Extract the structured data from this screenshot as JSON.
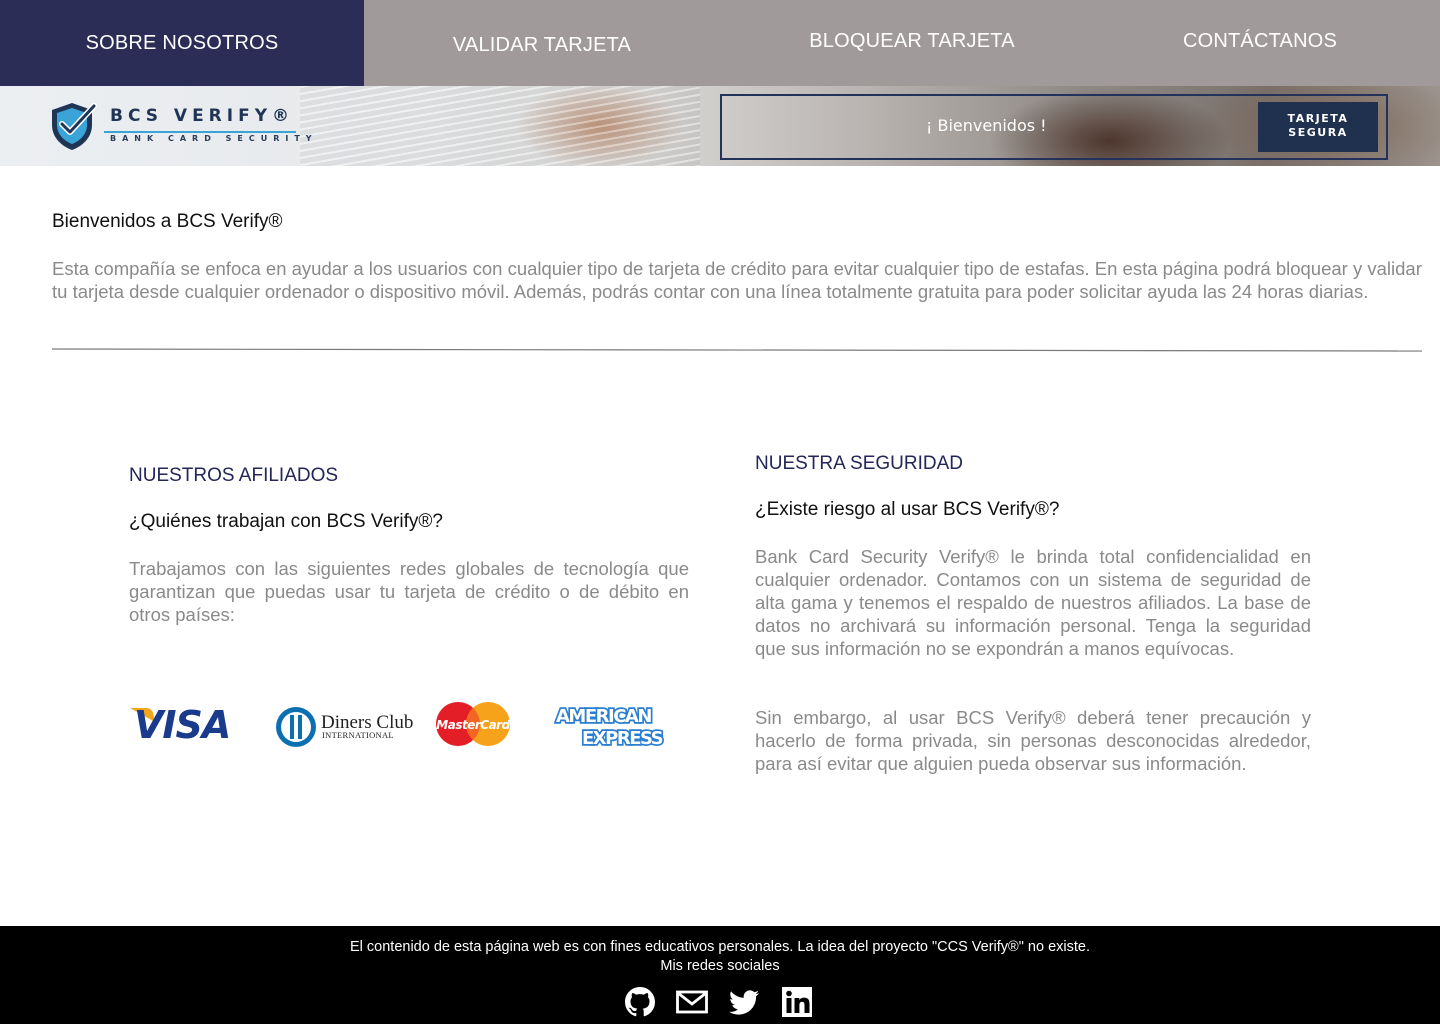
{
  "nav": {
    "items": [
      {
        "label": "SOBRE NOSOTROS",
        "active": true
      },
      {
        "label": "VALIDAR TARJETA",
        "active": false
      },
      {
        "label": "BLOQUEAR TARJETA",
        "active": false
      },
      {
        "label": "CONTÁCTANOS",
        "active": false
      }
    ],
    "active_color": "#2c2d57",
    "bar_color": "#a19a9a"
  },
  "banner": {
    "logo_title": "BCS VERIFY®",
    "logo_subtitle": "BANK CARD SECURITY",
    "welcome": "¡ Bienvenidos !",
    "badge": "TARJETA\nSEGURA"
  },
  "intro": {
    "title": "Bienvenidos a BCS Verify®",
    "body": "Esta compañía se enfoca en ayudar a los usuarios con cualquier tipo de tarjeta de crédito para evitar cualquier tipo de estafas. En esta página podrá bloquear y validar tu tarjeta desde cualquier ordenador o dispositivo móvil. Además, podrás contar con una línea totalmente gratuita para poder solicitar ayuda las 24 horas diarias."
  },
  "affiliates": {
    "heading": "NUESTROS AFILIADOS",
    "question": "¿Quiénes trabajan con BCS Verify®?",
    "body": "Trabajamos con las siguientes redes globales de tecnología que garantizan que puedas usar tu tarjeta de crédito o de débito en otros países:",
    "logos": [
      "visa-logo",
      "diners-club-logo",
      "mastercard-logo",
      "american-express-logo"
    ]
  },
  "security": {
    "heading": "NUESTRA SEGURIDAD",
    "question": "¿Existe riesgo al usar BCS Verify®?",
    "body1": "Bank Card Security Verify® le brinda total confidencialidad en cualquier ordenador. Contamos con un sistema de seguridad de alta gama y tenemos el respaldo de nuestros afiliados. La base de datos no archivará su información personal. Tenga la seguridad que sus información no se expondrán a manos equívocas.",
    "body2": "Sin embargo, al usar BCS Verify® deberá tener precaución y hacerlo de forma privada, sin personas desconocidas alrededor, para así evitar que alguien pueda observar sus información."
  },
  "footer": {
    "note": "El contenido de esta página web es con fines educativos personales. La idea del proyecto \"CCS Verify®\" no existe.",
    "social_label": "Mis redes sociales",
    "icons": [
      "github-icon",
      "mail-icon",
      "twitter-icon",
      "linkedin-icon"
    ]
  }
}
